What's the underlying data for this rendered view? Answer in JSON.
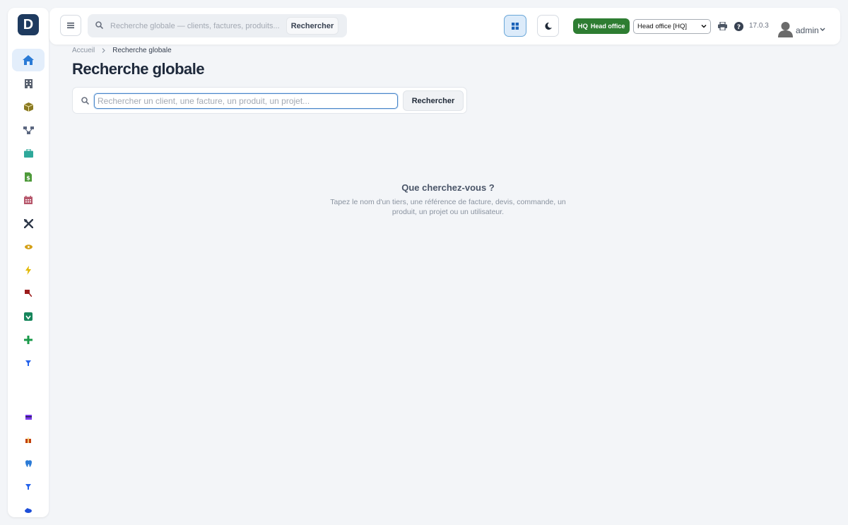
{
  "app": {
    "logo_letter": "D"
  },
  "topbar": {
    "search_placeholder": "Recherche globale — clients, factures, produits...",
    "search_button": "Rechercher",
    "entity_badge_code": "HQ",
    "entity_badge_label": "Head office",
    "entity_select_value": "Head office [HQ]",
    "version": "17.0.3",
    "user_name": "admin"
  },
  "breadcrumb": {
    "home": "Accueil",
    "current": "Recherche globale"
  },
  "page": {
    "title": "Recherche globale",
    "search_placeholder": "Rechercher un client, une facture, un produit, un projet...",
    "search_button": "Rechercher",
    "empty_title": "Que cherchez-vous ?",
    "empty_text": "Tapez le nom d'un tiers, une référence de facture, devis, commande, un produit, un projet ou un utilisateur."
  },
  "sidebar": {
    "items": [
      {
        "icon": "home-icon",
        "color": "#2b7bd6",
        "active": true
      },
      {
        "icon": "building-icon",
        "color": "#5a6270"
      },
      {
        "icon": "box-icon",
        "color": "#8a7a22"
      },
      {
        "icon": "workflow-icon",
        "color": "#5b6780"
      },
      {
        "icon": "briefcase-icon",
        "color": "#2ea89a"
      },
      {
        "icon": "invoice-dollar-icon",
        "color": "#4e9a3a"
      },
      {
        "icon": "calendar-icon",
        "color": "#b6556a"
      },
      {
        "icon": "tools-icon",
        "color": "#2d3748"
      },
      {
        "icon": "eye-icon",
        "color": "#d4a017"
      },
      {
        "icon": "bolt-icon",
        "color": "#e2b800"
      },
      {
        "icon": "flag-icon",
        "color": "#9b1c1c"
      },
      {
        "icon": "shield-check-icon",
        "color": "#16855b"
      },
      {
        "icon": "plus-icon",
        "color": "#1a9a4a"
      },
      {
        "icon": "filter-icon",
        "color": "#2563eb"
      },
      {
        "icon": "card-icon",
        "color": "#7c3aed"
      },
      {
        "icon": "gift-icon",
        "color": "#c2410c"
      },
      {
        "icon": "tooth-icon",
        "color": "#2b7bd6"
      },
      {
        "icon": "funnel-icon",
        "color": "#2563eb"
      },
      {
        "icon": "cloud-icon",
        "color": "#1d4ed8"
      }
    ]
  }
}
